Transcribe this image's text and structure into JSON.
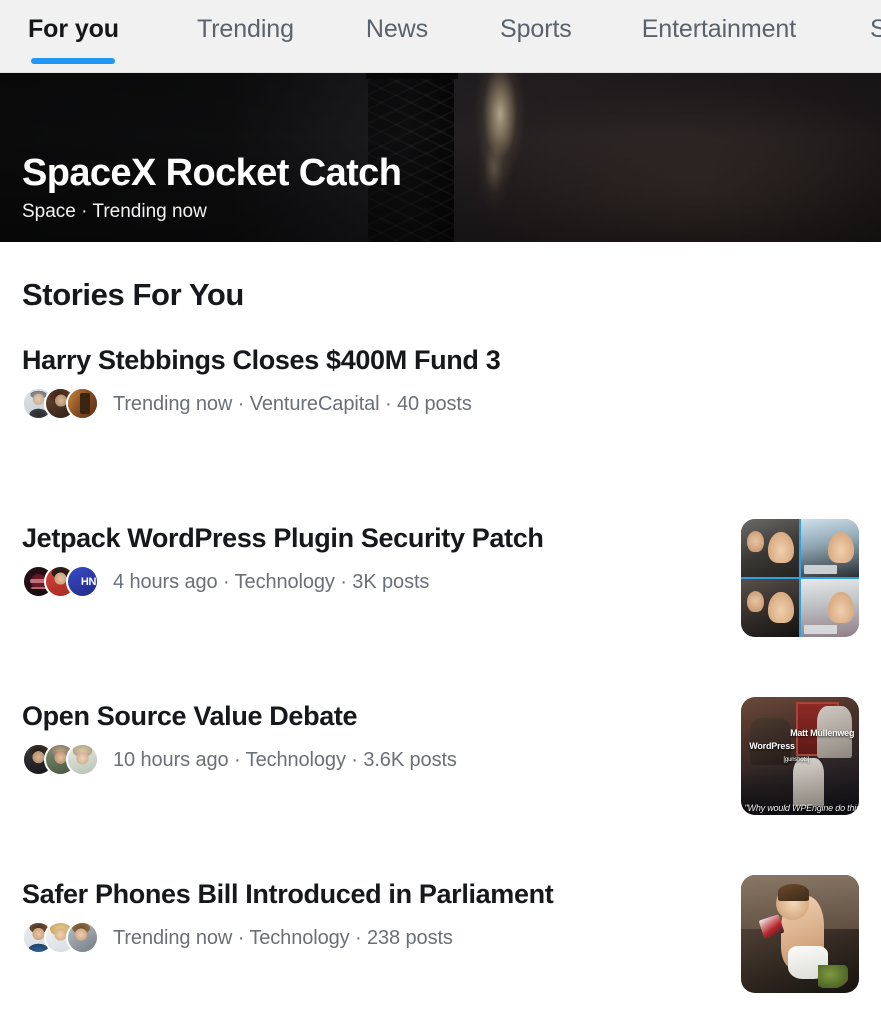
{
  "tabs": [
    {
      "label": "For you",
      "active": true
    },
    {
      "label": "Trending",
      "active": false
    },
    {
      "label": "News",
      "active": false
    },
    {
      "label": "Sports",
      "active": false
    },
    {
      "label": "Entertainment",
      "active": false
    },
    {
      "label": "Saved",
      "active": false
    }
  ],
  "hero": {
    "title": "SpaceX Rocket Catch",
    "subtitle": "Space · Trending now",
    "category": "Space",
    "status": "Trending now",
    "image_description": "launch-tower-with-rocket-exhaust-plume"
  },
  "section": {
    "title": "Stories For You"
  },
  "stories": [
    {
      "title": "Harry Stebbings Closes $400M Fund 3",
      "meta": "Trending now · VentureCapital · 40 posts",
      "time": "Trending now",
      "topic": "VentureCapital",
      "posts": "40 posts",
      "has_thumbnail": false,
      "thumbnail_description": "",
      "avatars": [
        "av-a1",
        "av-a2",
        "av-a3"
      ],
      "avatar_badges": [
        "",
        "",
        ""
      ]
    },
    {
      "title": "Jetpack WordPress Plugin Security Patch",
      "meta": "4 hours ago · Technology · 3K posts",
      "time": "4 hours ago",
      "topic": "Technology",
      "posts": "3K posts",
      "has_thumbnail": true,
      "thumbnail_description": "four-panel-video-call-people-waving",
      "avatars": [
        "av-b1",
        "av-b2",
        "av-b3"
      ],
      "avatar_badges": [
        "",
        "",
        "HN"
      ]
    },
    {
      "title": "Open Source Value Debate",
      "meta": "10 hours ago · Technology · 3.6K posts",
      "time": "10 hours ago",
      "topic": "Technology",
      "posts": "3.6K posts",
      "has_thumbnail": true,
      "thumbnail_description": "wordpress-matt-mullenweg-meme",
      "avatars": [
        "av-c1",
        "av-c2",
        "av-c3"
      ],
      "avatar_badges": [
        "",
        "",
        ""
      ]
    },
    {
      "title": "Safer Phones Bill Introduced in Parliament",
      "meta": "Trending now · Technology · 238 posts",
      "time": "Trending now",
      "topic": "Technology",
      "posts": "238 posts",
      "has_thumbnail": true,
      "thumbnail_description": "toddler-holding-mobile-phone",
      "avatars": [
        "av-d1",
        "av-d2",
        "av-d3"
      ],
      "avatar_badges": [
        "",
        "",
        ""
      ]
    }
  ],
  "thumbnail_labels": {
    "meme_wordpress": "WordPress",
    "meme_person": "Matt Mullenweg",
    "meme_gunshots": "[gunshots]",
    "meme_caption": "\"Why would WPEngine do this?\""
  },
  "colors": {
    "accent": "#2196f3",
    "tabbar_background": "#f1f1f1",
    "tab_inactive": "#5a636d",
    "tab_active": "#141619",
    "text_primary": "#16181b",
    "text_secondary": "#6b7077",
    "hero_background": "#161616",
    "page_background": "#ffffff"
  }
}
